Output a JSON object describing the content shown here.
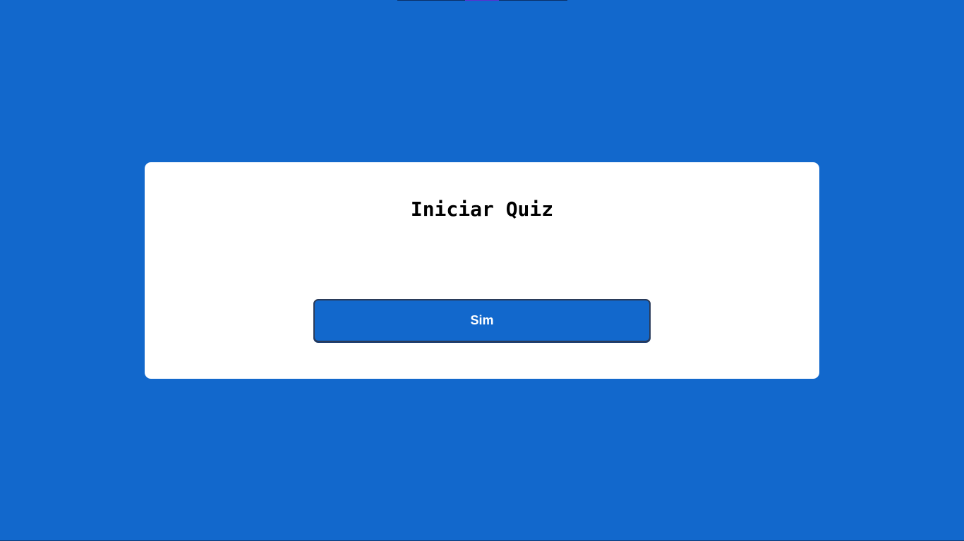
{
  "quiz": {
    "title": "Iniciar Quiz",
    "start_button_label": "Sim"
  },
  "colors": {
    "background": "#1268cc",
    "card": "#ffffff",
    "button": "#1268cc",
    "button_text": "#ffffff",
    "title_text": "#000000"
  }
}
